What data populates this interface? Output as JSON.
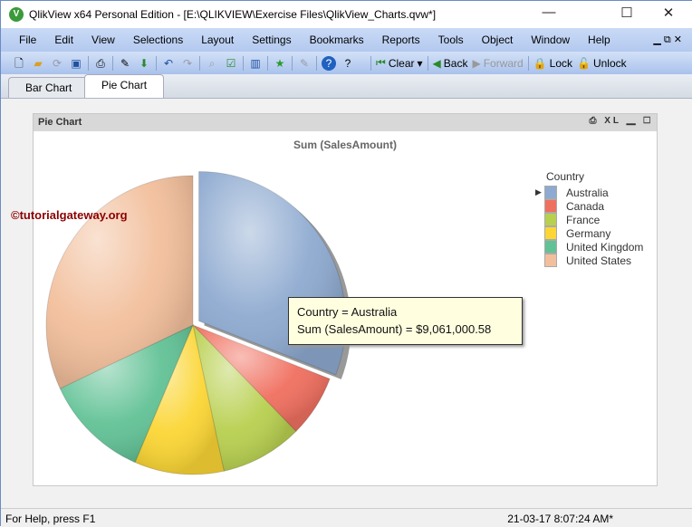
{
  "window": {
    "title": "QlikView x64 Personal Edition - [E:\\QLIKVIEW\\Exercise Files\\QlikView_Charts.qvw*]",
    "logo": "V",
    "minimize": "—",
    "maximize": "☐",
    "close": "✕"
  },
  "menu": [
    "File",
    "Edit",
    "View",
    "Selections",
    "Layout",
    "Settings",
    "Bookmarks",
    "Reports",
    "Tools",
    "Object",
    "Window",
    "Help"
  ],
  "toolbar": {
    "clear": "Clear",
    "back": "Back",
    "forward": "Forward",
    "lock": "Lock",
    "unlock": "Unlock"
  },
  "tabs": [
    {
      "label": "Bar Chart"
    },
    {
      "label": "Pie Chart",
      "active": true
    }
  ],
  "object": {
    "caption": "Pie Chart",
    "icons": "XL"
  },
  "watermark": "©tutorialgateway.org",
  "tooltip": {
    "line1": "Country = Australia",
    "line2": "Sum (SalesAmount) = $9,061,000.58"
  },
  "chart_data": {
    "type": "pie",
    "title": "Sum (SalesAmount)",
    "legend_title": "Country",
    "legend_position": "right",
    "categories": [
      "Australia",
      "Canada",
      "France",
      "Germany",
      "United Kingdom",
      "United States"
    ],
    "values": [
      9061000.58,
      1977844.86,
      2644017.71,
      2894312.34,
      3391712.21,
      9389789.51
    ],
    "colors": [
      "#8eaad0",
      "#f07060",
      "#b8d050",
      "#fbd635",
      "#62c296",
      "#f2bf9c"
    ],
    "exploded": "Australia",
    "selected_legend": "Australia"
  },
  "status": {
    "help": "For Help, press F1",
    "time": "21-03-17 8:07:24 AM*"
  }
}
